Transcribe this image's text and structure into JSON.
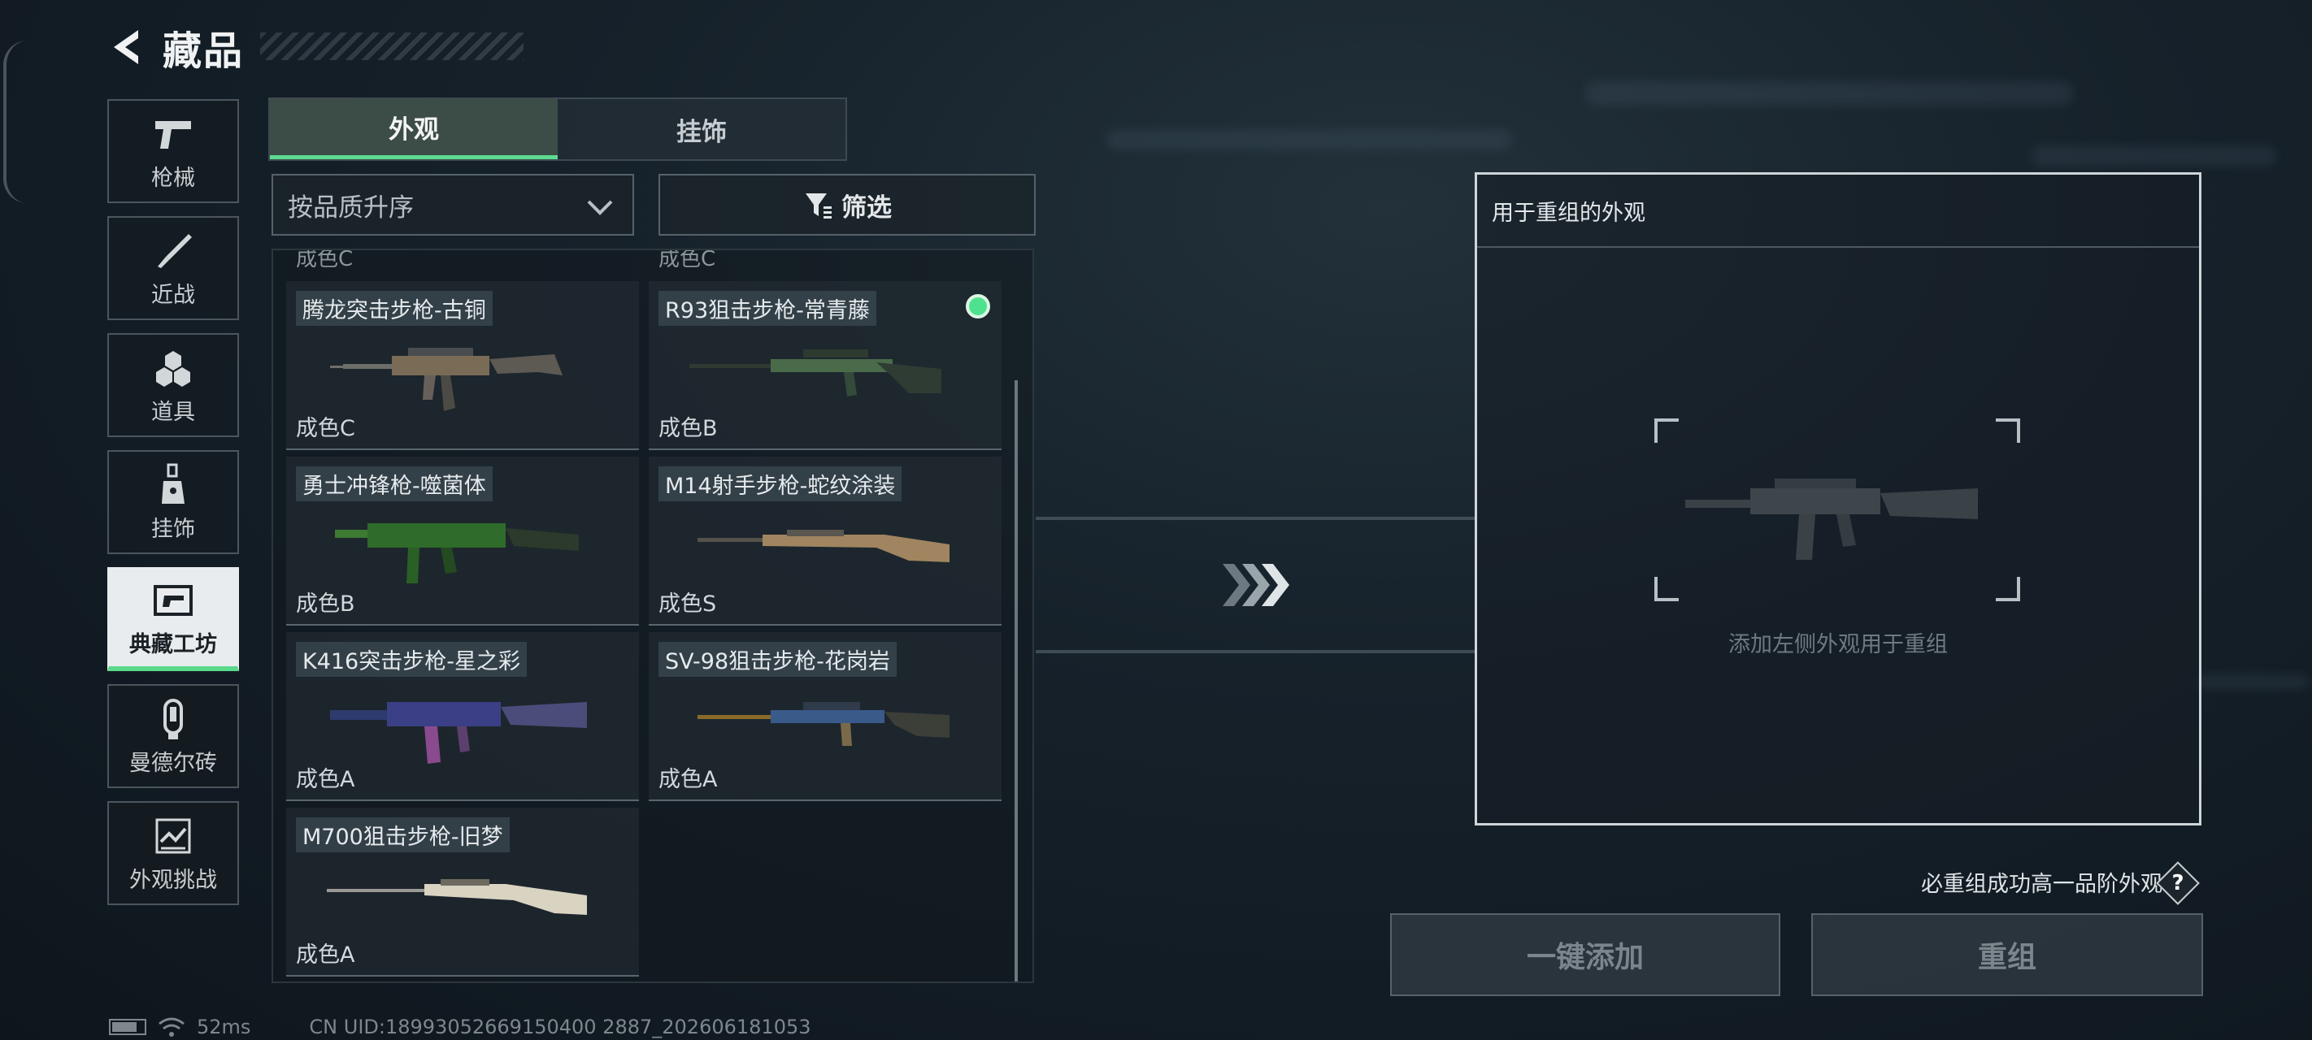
{
  "header": {
    "title": "藏品"
  },
  "sidebar": {
    "items": [
      {
        "label": "枪械",
        "icon": "pistol-icon"
      },
      {
        "label": "近战",
        "icon": "knife-icon"
      },
      {
        "label": "道具",
        "icon": "grenades-icon"
      },
      {
        "label": "挂饰",
        "icon": "charm-icon"
      },
      {
        "label": "典藏工坊",
        "icon": "workshop-icon",
        "active": true
      },
      {
        "label": "曼德尔砖",
        "icon": "mandel-brick-icon"
      },
      {
        "label": "外观挑战",
        "icon": "challenge-icon"
      }
    ]
  },
  "tabs": [
    {
      "label": "外观",
      "active": true
    },
    {
      "label": "挂饰",
      "active": false
    }
  ],
  "sort": {
    "label": "按品质升序"
  },
  "filter": {
    "label": "筛选"
  },
  "partial_grades": [
    "成色C",
    "成色C"
  ],
  "items": [
    {
      "name": "腾龙突击步枪-古铜",
      "grade": "成色C",
      "selected": false
    },
    {
      "name": "R93狙击步枪-常青藤",
      "grade": "成色B",
      "selected": true
    },
    {
      "name": "勇士冲锋枪-噬菌体",
      "grade": "成色B",
      "selected": false
    },
    {
      "name": "M14射手步枪-蛇纹涂装",
      "grade": "成色S",
      "selected": false
    },
    {
      "name": "K416突击步枪-星之彩",
      "grade": "成色A",
      "selected": false
    },
    {
      "name": "SV-98狙击步枪-花岗岩",
      "grade": "成色A",
      "selected": false
    },
    {
      "name": "M700狙击步枪-旧梦",
      "grade": "成色A",
      "selected": false
    }
  ],
  "panel": {
    "title": "用于重组的外观",
    "hint": "添加左侧外观用于重组"
  },
  "guarantee_text": "必重组成功高一品阶外观",
  "help_label": "?",
  "buttons": {
    "add_all": "一键添加",
    "recompose": "重组"
  },
  "status": {
    "ping": "52ms",
    "uid": "CN UID:18993052669150400 2887_202606181053"
  },
  "colors": {
    "accent": "#59d98a",
    "selected": "#4fe28e"
  }
}
